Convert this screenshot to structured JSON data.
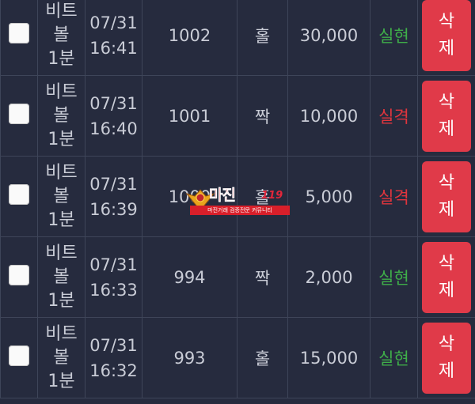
{
  "rows": [
    {
      "game": "비트\n볼\n1분",
      "time": "07/31\n16:41",
      "round": "1002",
      "pick": "홀",
      "amount": "30,000",
      "result": "실현",
      "result_type": "success",
      "delete_label": "삭\n제"
    },
    {
      "game": "비트\n볼\n1분",
      "time": "07/31\n16:40",
      "round": "1001",
      "pick": "짝",
      "amount": "10,000",
      "result": "실격",
      "result_type": "fail",
      "delete_label": "삭\n제"
    },
    {
      "game": "비트\n볼\n1분",
      "time": "07/31\n16:39",
      "round": "1000",
      "pick": "홀",
      "amount": "5,000",
      "result": "실격",
      "result_type": "fail",
      "delete_label": "삭\n제"
    },
    {
      "game": "비트\n볼\n1분",
      "time": "07/31\n16:33",
      "round": "994",
      "pick": "짝",
      "amount": "2,000",
      "result": "실현",
      "result_type": "success",
      "delete_label": "삭\n제"
    },
    {
      "game": "비트\n볼\n1분",
      "time": "07/31\n16:32",
      "round": "993",
      "pick": "홀",
      "amount": "15,000",
      "result": "실현",
      "result_type": "success",
      "delete_label": "삭\n제"
    }
  ],
  "watermark": {
    "title": "마진",
    "number": "119",
    "tagline": "마진거래 검증전문 커뮤니티"
  },
  "colors": {
    "background": "#262b3e",
    "grid": "#3e4559",
    "success": "#3fae49",
    "fail": "#e0353d",
    "delete_button": "#e03a49"
  },
  "icons": {
    "checkbox": "checkbox-icon",
    "watermark": "eagle-badge-icon"
  }
}
